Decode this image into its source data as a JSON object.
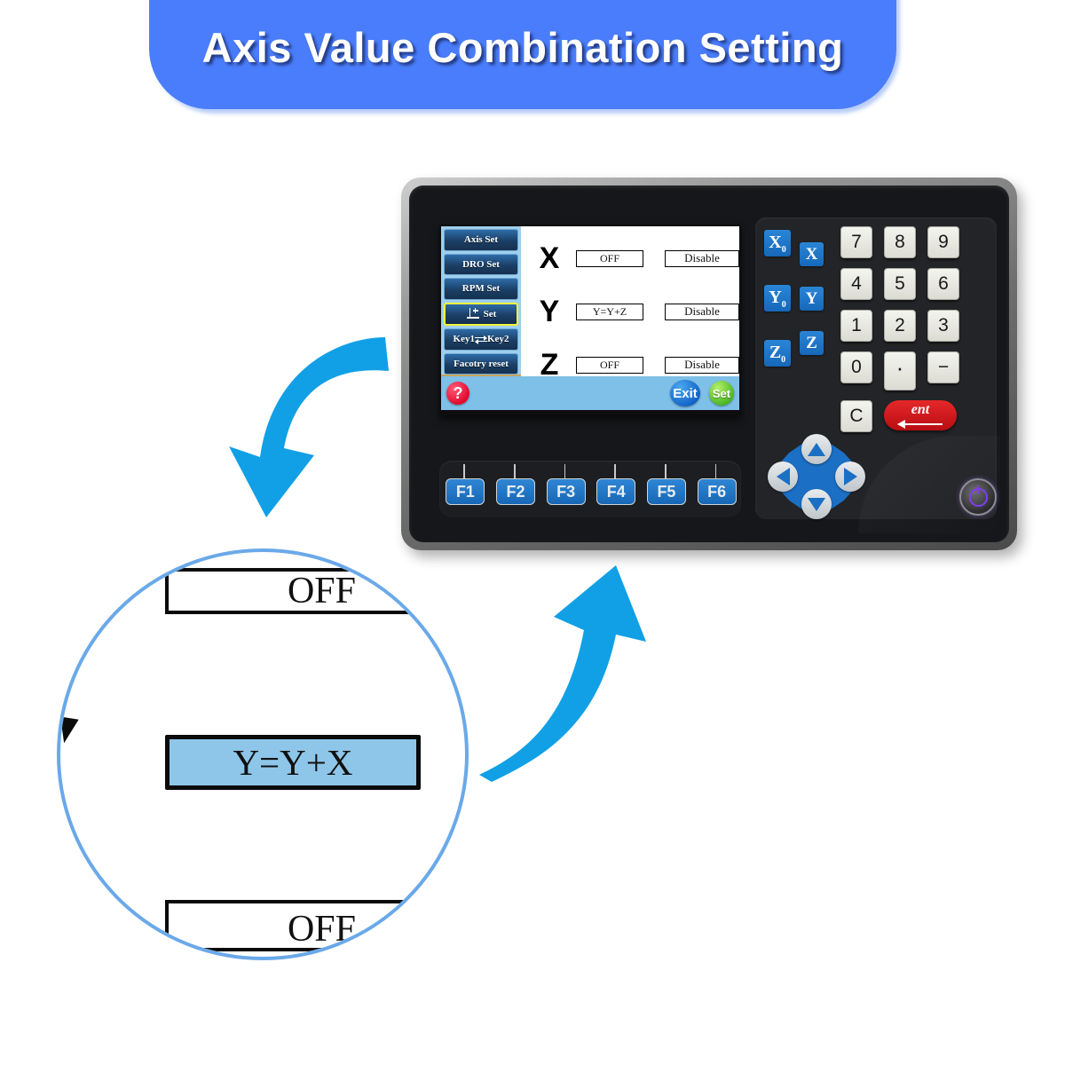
{
  "banner": {
    "title": "Axis Value Combination Setting",
    "bg_color": "#4a7dfb",
    "text_color": "#ffffff"
  },
  "device": {
    "screen": {
      "sidebar": [
        {
          "label": "Axis Set",
          "selected": false
        },
        {
          "label": "DRO Set",
          "selected": false
        },
        {
          "label": "RPM  Set",
          "selected": false
        },
        {
          "label": "Set",
          "icon": "axis-plus-icon",
          "selected": true
        },
        {
          "label_left": "Key1",
          "label_right": "Key2",
          "icon": "swap-arrows-icon",
          "selected": false
        },
        {
          "label": "Facotry reset",
          "selected": false
        }
      ],
      "axis_rows": [
        {
          "axis": "X",
          "combination": "OFF",
          "state": "Disable"
        },
        {
          "axis": "Y",
          "combination": "Y=Y+Z",
          "state": "Disable"
        },
        {
          "axis": "Z",
          "combination": "OFF",
          "state": "Disable"
        }
      ],
      "statusbar": {
        "help": "?",
        "exit": "Exit",
        "set": "Set",
        "bg_color": "#7fc0e8",
        "help_color": "#e20a2e",
        "exit_color": "#1160c6",
        "set_color": "#47b321"
      }
    },
    "function_keys": [
      "F1",
      "F2",
      "F3",
      "F4",
      "F5",
      "F6"
    ],
    "axis_keys": [
      {
        "label": "X",
        "sub": "0"
      },
      {
        "label": "X",
        "sub": ""
      },
      {
        "label": "Y",
        "sub": "0"
      },
      {
        "label": "Y",
        "sub": ""
      },
      {
        "label": "Z",
        "sub": "0"
      },
      {
        "label": "Z",
        "sub": ""
      }
    ],
    "numpad": [
      [
        "7",
        "8",
        "9"
      ],
      [
        "4",
        "5",
        "6"
      ],
      [
        "1",
        "2",
        "3"
      ],
      [
        "0",
        "·",
        "−"
      ]
    ],
    "clear_key": "C",
    "enter_key": "ent",
    "dpad": [
      "up",
      "down",
      "left",
      "right"
    ],
    "power": "power-icon"
  },
  "magnifier": {
    "top_value": "OFF",
    "highlighted_value": "Y=Y+X",
    "bottom_value": "OFF",
    "ring_color": "#6aa9e9",
    "highlight_color": "#8ec6e9"
  },
  "arrows": {
    "color": "#11a0e6",
    "left": "curved-arrow-down-left",
    "right": "curved-arrow-up-right"
  }
}
